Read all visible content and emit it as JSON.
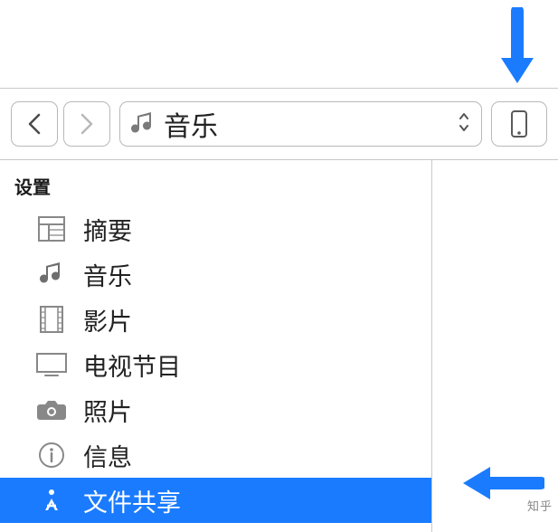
{
  "annotation": {
    "arrow_down_target": "device-button",
    "arrow_left_target": "sidebar-item-file-sharing"
  },
  "toolbar": {
    "back_label": "Back",
    "forward_label": "Forward",
    "dropdown": {
      "icon": "music-icon",
      "label": "音乐"
    },
    "device_label": "Device"
  },
  "sidebar": {
    "section_title": "设置",
    "items": [
      {
        "icon": "summary-icon",
        "label": "摘要",
        "selected": false
      },
      {
        "icon": "music-icon",
        "label": "音乐",
        "selected": false
      },
      {
        "icon": "movies-icon",
        "label": "影片",
        "selected": false
      },
      {
        "icon": "tv-icon",
        "label": "电视节目",
        "selected": false
      },
      {
        "icon": "photos-icon",
        "label": "照片",
        "selected": false
      },
      {
        "icon": "info-icon",
        "label": "信息",
        "selected": false
      },
      {
        "icon": "apps-icon",
        "label": "文件共享",
        "selected": true
      }
    ]
  },
  "watermark": "知乎"
}
